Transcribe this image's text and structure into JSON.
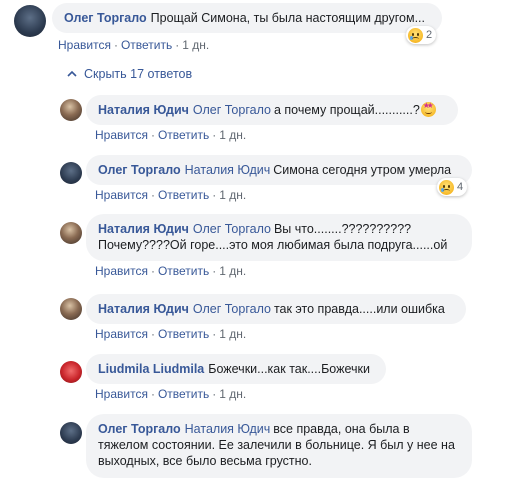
{
  "top_comment": {
    "author": "Олег Торгало",
    "text": "Прощай Симона, ты была настоящим другом...",
    "actions": {
      "like": "Нравится",
      "reply": "Ответить",
      "time": "1 дн."
    },
    "reaction_count": "2"
  },
  "toggle_replies": {
    "label": "Скрыть 17 ответов"
  },
  "replies": [
    {
      "author": "Наталия Юдич",
      "mention": "Олег Торгало",
      "text": "а почему прощай...........?",
      "actions": {
        "like": "Нравится",
        "reply": "Ответить",
        "time": "1 дн."
      }
    },
    {
      "author": "Олег Торгало",
      "mention": "Наталия Юдич",
      "text": "Симона сегодня утром умерла",
      "actions": {
        "like": "Нравится",
        "reply": "Ответить",
        "time": "1 дн."
      },
      "reaction_count": "4"
    },
    {
      "author": "Наталия Юдич",
      "mention": "Олег Торгало",
      "text": "Вы что........??????????",
      "text_line2": "Почему????Ой горе....это моя любимая была подруга......ой",
      "actions": {
        "like": "Нравится",
        "reply": "Ответить",
        "time": "1 дн."
      }
    },
    {
      "author": "Наталия Юдич",
      "mention": "Олег Торгало",
      "text": "так это правда.....или ошибка",
      "actions": {
        "like": "Нравится",
        "reply": "Ответить",
        "time": "1 дн."
      }
    },
    {
      "author": "Liudmila Liudmila",
      "text": "Божечки...как так....Божечки",
      "actions": {
        "like": "Нравится",
        "reply": "Ответить",
        "time": "1 дн."
      }
    },
    {
      "author": "Олег Торгало",
      "mention": "Наталия Юдич",
      "text": "все правда, она была в",
      "text_line2": "тяжелом состоянии. Ее залечили в больнице. Я был у нее на",
      "text_line3": "выходных, все было весьма грустно."
    }
  ],
  "colors": {
    "link": "#385898",
    "bubble": "#f2f3f5",
    "meta": "#606770"
  },
  "icons": {
    "reaction": "sad-reaction-icon",
    "inline_emoji": "star-struck-emoji-icon",
    "toggle": "chevron-up-icon"
  }
}
